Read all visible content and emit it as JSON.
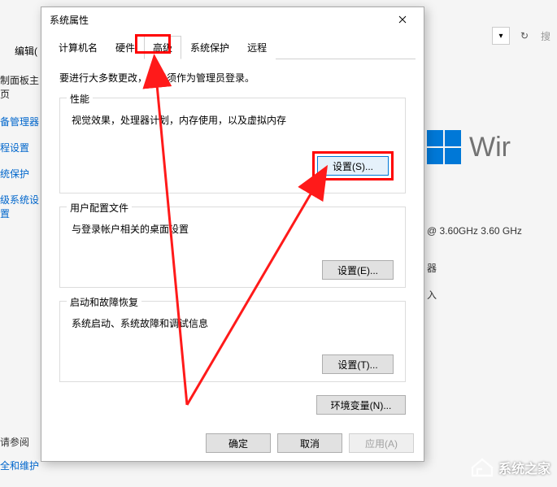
{
  "bg": {
    "edit_label": "编辑(",
    "sidebar_items": [
      "制面板主页",
      "备管理器",
      "程设置",
      "统保护",
      "级系统设置"
    ],
    "search_placeholder": "搜",
    "cpu_spec": "@ 3.60GHz   3.60 GHz",
    "spec_labels": [
      "器",
      "入"
    ],
    "windows_text": "Wir",
    "bottom_links": [
      "请参阅",
      "全和维护"
    ]
  },
  "dialog": {
    "title": "系统属性",
    "tabs": {
      "computer_name": "计算机名",
      "hardware": "硬件",
      "advanced": "高级",
      "system_protection": "系统保护",
      "remote": "远程"
    },
    "admin_note": "要进行大多数更改，你必须作为管理员登录。",
    "performance": {
      "title": "性能",
      "desc": "视觉效果，处理器计划，内存使用，以及虚拟内存",
      "button": "设置(S)..."
    },
    "user_profiles": {
      "title": "用户配置文件",
      "desc": "与登录帐户相关的桌面设置",
      "button": "设置(E)..."
    },
    "startup": {
      "title": "启动和故障恢复",
      "desc": "系统启动、系统故障和调试信息",
      "button": "设置(T)..."
    },
    "env_button": "环境变量(N)...",
    "buttons": {
      "ok": "确定",
      "cancel": "取消",
      "apply": "应用(A)"
    }
  },
  "watermark": "系统之家"
}
